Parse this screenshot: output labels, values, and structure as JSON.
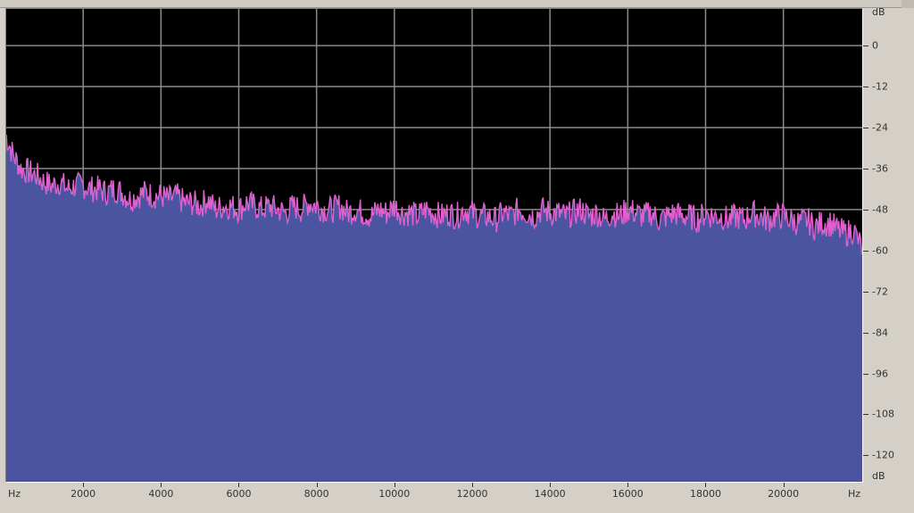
{
  "window": {
    "title": ""
  },
  "axes": {
    "y_unit_top": "dB",
    "y_unit_bottom": "dB",
    "x_unit_left": "Hz",
    "x_unit_right": "Hz"
  },
  "colors": {
    "plot_bg": "#000000",
    "grid": "#8a8a8a",
    "fill": "#4a54a0",
    "trace": "#e060d0",
    "chrome": "#d4d0c8"
  },
  "chart_data": {
    "type": "area",
    "title": "",
    "xlabel": "Hz",
    "ylabel": "dB",
    "xlim": [
      0,
      22050
    ],
    "ylim": [
      -128,
      11
    ],
    "grid": true,
    "x_ticks": [
      "2000",
      "4000",
      "6000",
      "8000",
      "10000",
      "12000",
      "14000",
      "16000",
      "18000",
      "20000"
    ],
    "y_ticks": [
      "0",
      "-12",
      "-24",
      "-36",
      "-48",
      "-60",
      "-72",
      "-84",
      "-96",
      "-108",
      "-120"
    ],
    "x_tick_values": [
      2000,
      4000,
      6000,
      8000,
      10000,
      12000,
      14000,
      16000,
      18000,
      20000
    ],
    "y_tick_values": [
      0,
      -12,
      -24,
      -36,
      -48,
      -60,
      -72,
      -84,
      -96,
      -108,
      -120
    ],
    "series": [
      {
        "x": [
          0,
          200,
          400,
          600,
          800,
          1000,
          1200,
          1400,
          1600,
          1800,
          2000,
          2200,
          2400,
          2600,
          2800,
          3000,
          3200,
          3400,
          3600,
          3800,
          4000,
          4200,
          4400,
          4600,
          4800,
          5000,
          5200,
          5400,
          5600,
          5800,
          6000,
          6200,
          6400,
          6600,
          6800,
          7000,
          7200,
          7400,
          7600,
          7800,
          8000,
          8200,
          8400,
          8600,
          8800,
          9000,
          9200,
          9400,
          9600,
          9800,
          10000,
          10200,
          10400,
          10600,
          10800,
          11000,
          11200,
          11400,
          11600,
          11800,
          12000,
          12200,
          12400,
          12600,
          12800,
          13000,
          13200,
          13400,
          13600,
          13800,
          14000,
          14200,
          14400,
          14600,
          14800,
          15000,
          15200,
          15400,
          15600,
          15800,
          16000,
          16200,
          16400,
          16600,
          16800,
          17000,
          17200,
          17400,
          17600,
          17800,
          18000,
          18200,
          18400,
          18600,
          18800,
          19000,
          19200,
          19400,
          19600,
          19800,
          20000,
          20200,
          20400,
          20600,
          20800,
          21000,
          21200,
          21400,
          21600,
          21800,
          22050
        ],
        "values": [
          -26,
          -32,
          -36,
          -37,
          -38,
          -40,
          -41,
          -40,
          -42,
          -41,
          -41,
          -42,
          -42,
          -43,
          -42,
          -43,
          -45,
          -44,
          -43,
          -44,
          -44,
          -45,
          -44,
          -46,
          -46,
          -47,
          -45,
          -48,
          -47,
          -47,
          -48,
          -46,
          -47,
          -48,
          -47,
          -48,
          -49,
          -47,
          -48,
          -46,
          -47,
          -48,
          -48,
          -47,
          -49,
          -48,
          -49,
          -50,
          -48,
          -49,
          -47,
          -49,
          -49,
          -50,
          -48,
          -49,
          -50,
          -49,
          -50,
          -48,
          -49,
          -50,
          -50,
          -51,
          -49,
          -50,
          -48,
          -49,
          -50,
          -48,
          -49,
          -49,
          -50,
          -49,
          -48,
          -50,
          -49,
          -51,
          -49,
          -50,
          -48,
          -49,
          -50,
          -49,
          -51,
          -50,
          -49,
          -50,
          -50,
          -51,
          -49,
          -50,
          -50,
          -51,
          -50,
          -51,
          -49,
          -50,
          -51,
          -50,
          -50,
          -51,
          -52,
          -51,
          -53,
          -52,
          -52,
          -54,
          -55,
          -54,
          -60
        ]
      }
    ]
  }
}
